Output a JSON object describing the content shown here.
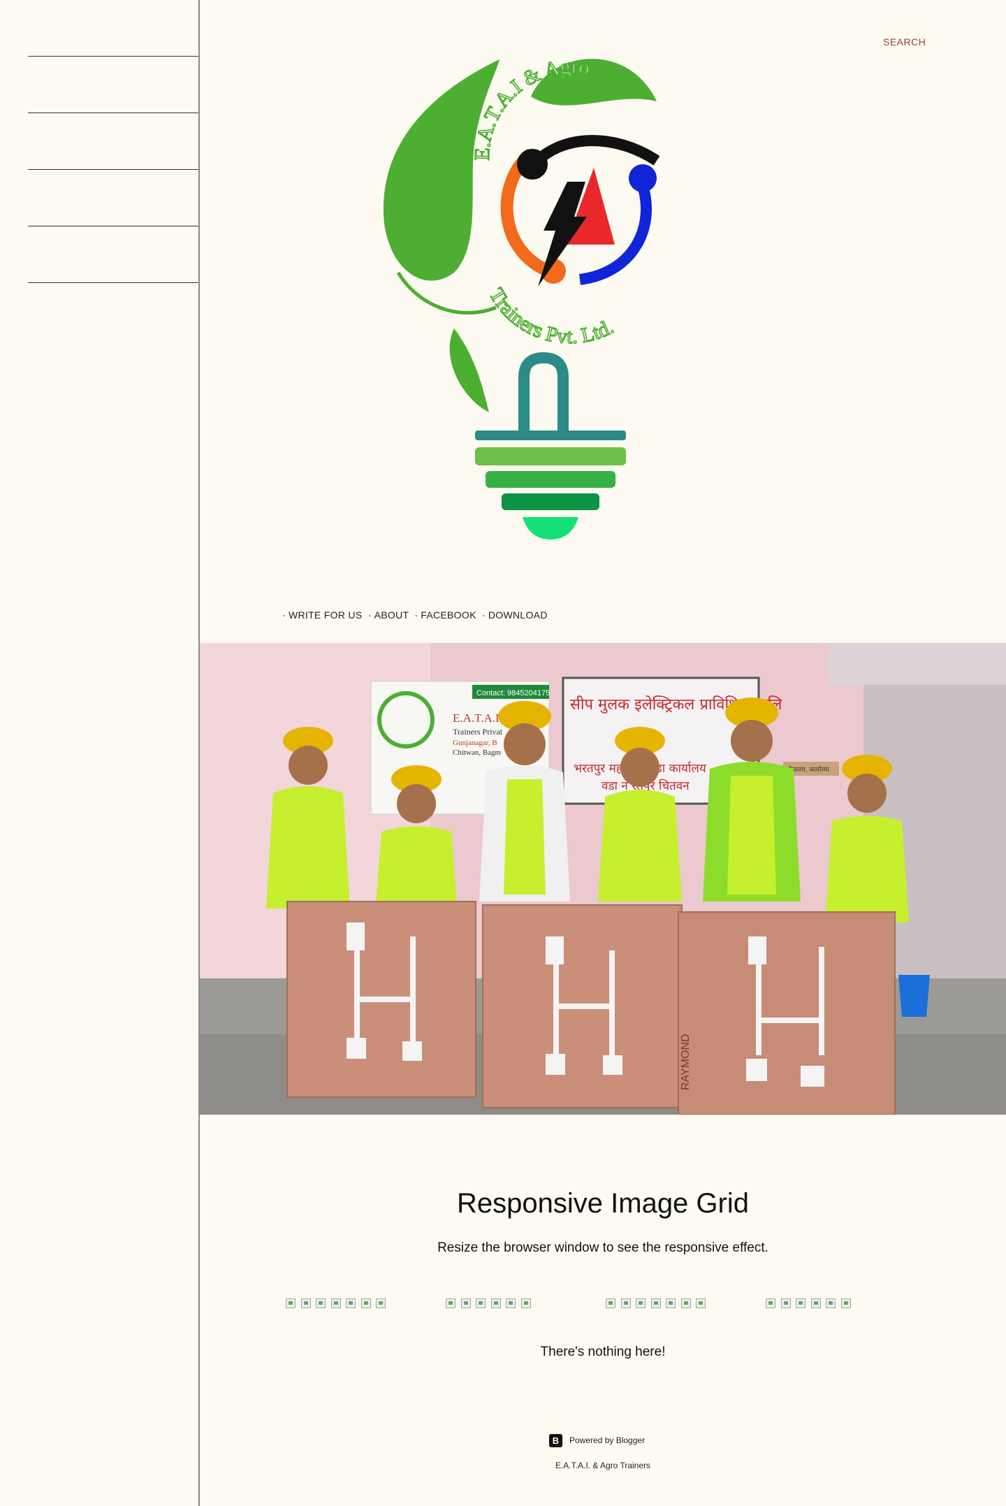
{
  "header": {
    "search_label": "SEARCH"
  },
  "logo": {
    "text_top": "E.A.T.A.I & Agro",
    "text_bottom": "Trainers Pvt. Ltd.",
    "colors": {
      "leaf_green": "#4caf32",
      "orange": "#f26a1b",
      "red": "#e8282b",
      "blue": "#1024d8",
      "black": "#111111",
      "teal": "#2b8b86",
      "light_green": "#6cc04a",
      "mid_green": "#38b048",
      "dark_green": "#0c9444",
      "bright_green": "#16e07a"
    }
  },
  "nav": {
    "items": [
      {
        "label": "WRITE FOR US"
      },
      {
        "label": "ABOUT"
      },
      {
        "label": "FACEBOOK"
      },
      {
        "label": "DOWNLOAD"
      }
    ]
  },
  "hero": {
    "banner_contact": "Contact: 9845204175",
    "banner_company": "E.A.T.A.I. A",
    "banner_sub1": "Trainers Privat",
    "banner_sub2": "Gunjanagar, B",
    "banner_sub3": "Chitwan, Bagm",
    "banner2_line1": "सीप मुलक इलेक्ट्रिकल प्राविधिक तालि",
    "banner2_line2": "भरतपुर मह     मका वडा कार्यालय",
    "banner2_line3": "वडा न      रतपुर चितवन",
    "door_sign": "शौचालय, कार्यालय",
    "board_text": "RAYMOND"
  },
  "grid": {
    "title": "Responsive Image Grid",
    "subtitle": "Resize the browser window to see the responsive effect.",
    "columns": [
      7,
      6,
      7,
      6
    ],
    "empty_message": "There's nothing here!"
  },
  "footer": {
    "powered_by": "Powered by Blogger",
    "site_name": "E.A.T.A.I. & Agro Trainers"
  }
}
